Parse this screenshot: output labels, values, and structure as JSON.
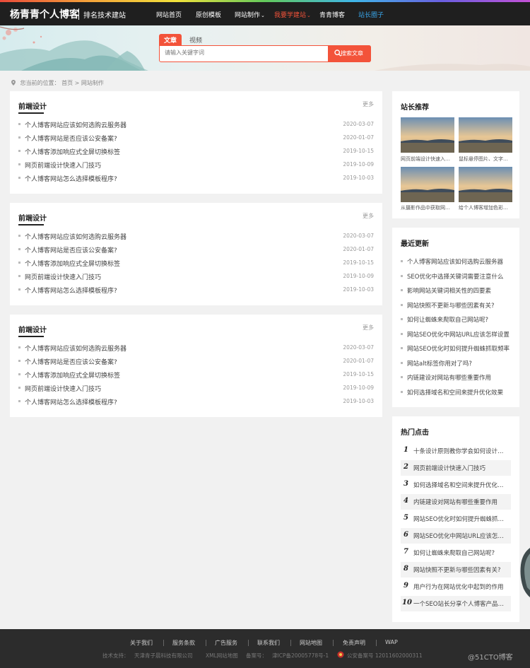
{
  "header": {
    "site_name": "杨青青个人博客",
    "tagline": "排名技术建站",
    "nav": [
      {
        "label": "网站首页"
      },
      {
        "label": "原创模板"
      },
      {
        "label": "网站制作"
      },
      {
        "label": "我要学建站"
      },
      {
        "label": "青青博客"
      },
      {
        "label": "站长圈子"
      }
    ]
  },
  "search": {
    "tabs": [
      "文章",
      "视频"
    ],
    "placeholder": "请输入关键字词",
    "button_label": "搜索文章"
  },
  "breadcrumb": {
    "prefix": "您当前的位置：",
    "home": "首页",
    "separator": ">",
    "current": "网站制作"
  },
  "panels": [
    {
      "title": "前端设计",
      "more": "更多",
      "articles": [
        {
          "title": "个人博客网站应该如何选购云服务器",
          "date": "2020-03-07"
        },
        {
          "title": "个人博客网站是否应该公安备案?",
          "date": "2020-01-07"
        },
        {
          "title": "个人博客添加响应式全屏切换标签",
          "date": "2019-10-15"
        },
        {
          "title": "网页前端设计快速入门技巧",
          "date": "2019-10-09"
        },
        {
          "title": "个人博客网站怎么选择模板程序?",
          "date": "2019-10-03"
        }
      ]
    },
    {
      "title": "前端设计",
      "more": "更多",
      "articles": [
        {
          "title": "个人博客网站应该如何选购云服务器",
          "date": "2020-03-07"
        },
        {
          "title": "个人博客网站是否应该公安备案?",
          "date": "2020-01-07"
        },
        {
          "title": "个人博客添加响应式全屏切换标签",
          "date": "2019-10-15"
        },
        {
          "title": "网页前端设计快速入门技巧",
          "date": "2019-10-09"
        },
        {
          "title": "个人博客网站怎么选择模板程序?",
          "date": "2019-10-03"
        }
      ]
    },
    {
      "title": "前端设计",
      "more": "更多",
      "articles": [
        {
          "title": "个人博客网站应该如何选购云服务器",
          "date": "2020-03-07"
        },
        {
          "title": "个人博客网站是否应该公安备案?",
          "date": "2020-01-07"
        },
        {
          "title": "个人博客添加响应式全屏切换标签",
          "date": "2019-10-15"
        },
        {
          "title": "网页前端设计快速入门技巧",
          "date": "2019-10-09"
        },
        {
          "title": "个人博客网站怎么选择模板程序?",
          "date": "2019-10-03"
        }
      ]
    }
  ],
  "sidebar": {
    "recommend": {
      "title": "站长推荐",
      "items": [
        {
          "caption": "网页前端设计快速入门技巧"
        },
        {
          "caption": "鼠标悬停图片、文字动画效果"
        },
        {
          "caption": "从摄影作品中获取网页配色"
        },
        {
          "caption": "给个人博客增加色彩搭配"
        }
      ]
    },
    "latest": {
      "title": "最近更新",
      "items": [
        "个人博客网站应该如何选购云服务器",
        "SEO优化中选择关键词需要注意什么",
        "影响网站关键词相关性的四要素",
        "网站快照不更新与哪些因素有关?",
        "如何让蜘蛛来爬取自己网站呢?",
        "网站SEO优化中网站URL应该怎样设置",
        "网站SEO优化时如何提升蜘蛛抓取频率",
        "网站alt标签你用对了吗?",
        "内链建设对网站有哪些重要作用",
        "如何选择域名和空间来提升优化效果"
      ]
    },
    "hot": {
      "title": "热门点击",
      "items": [
        {
          "rank": "1",
          "title": "十条设计原则教你学会如何设计网页"
        },
        {
          "rank": "2",
          "title": "网页前端设计快速入门技巧"
        },
        {
          "rank": "3",
          "title": "如何选择域名和空间来提升优化效果"
        },
        {
          "rank": "4",
          "title": "内链建设对网站有哪些重要作用"
        },
        {
          "rank": "5",
          "title": "网站SEO优化时如何提升蜘蛛抓取频率"
        },
        {
          "rank": "6",
          "title": "网站SEO优化中网站URL应该怎样设置"
        },
        {
          "rank": "7",
          "title": "如何让蜘蛛来爬取自己网站呢?"
        },
        {
          "rank": "8",
          "title": "网站快照不更新与哪些因素有关?"
        },
        {
          "rank": "9",
          "title": "用户行为在网站优化中起到的作用"
        },
        {
          "rank": "10",
          "title": "一个SEO站长分享个人博客产品的思路"
        }
      ]
    }
  },
  "footer": {
    "links": [
      "关于我们",
      "服务条款",
      "广告服务",
      "联系我们",
      "网站地图",
      "免责声明",
      "WAP"
    ],
    "info": [
      "技术支持：",
      "天津青子晨科技有限公司",
      "XML网站地图",
      "备案号：",
      "津ICP备20005778号-1",
      "公安备案号 12011602000311"
    ]
  },
  "watermark": "@51CTO博客",
  "colors": {
    "accent": "#f3533a",
    "nav_blue": "#39a6ea",
    "topbar": "#1f1f1f",
    "footer": "#2c2c2c"
  }
}
